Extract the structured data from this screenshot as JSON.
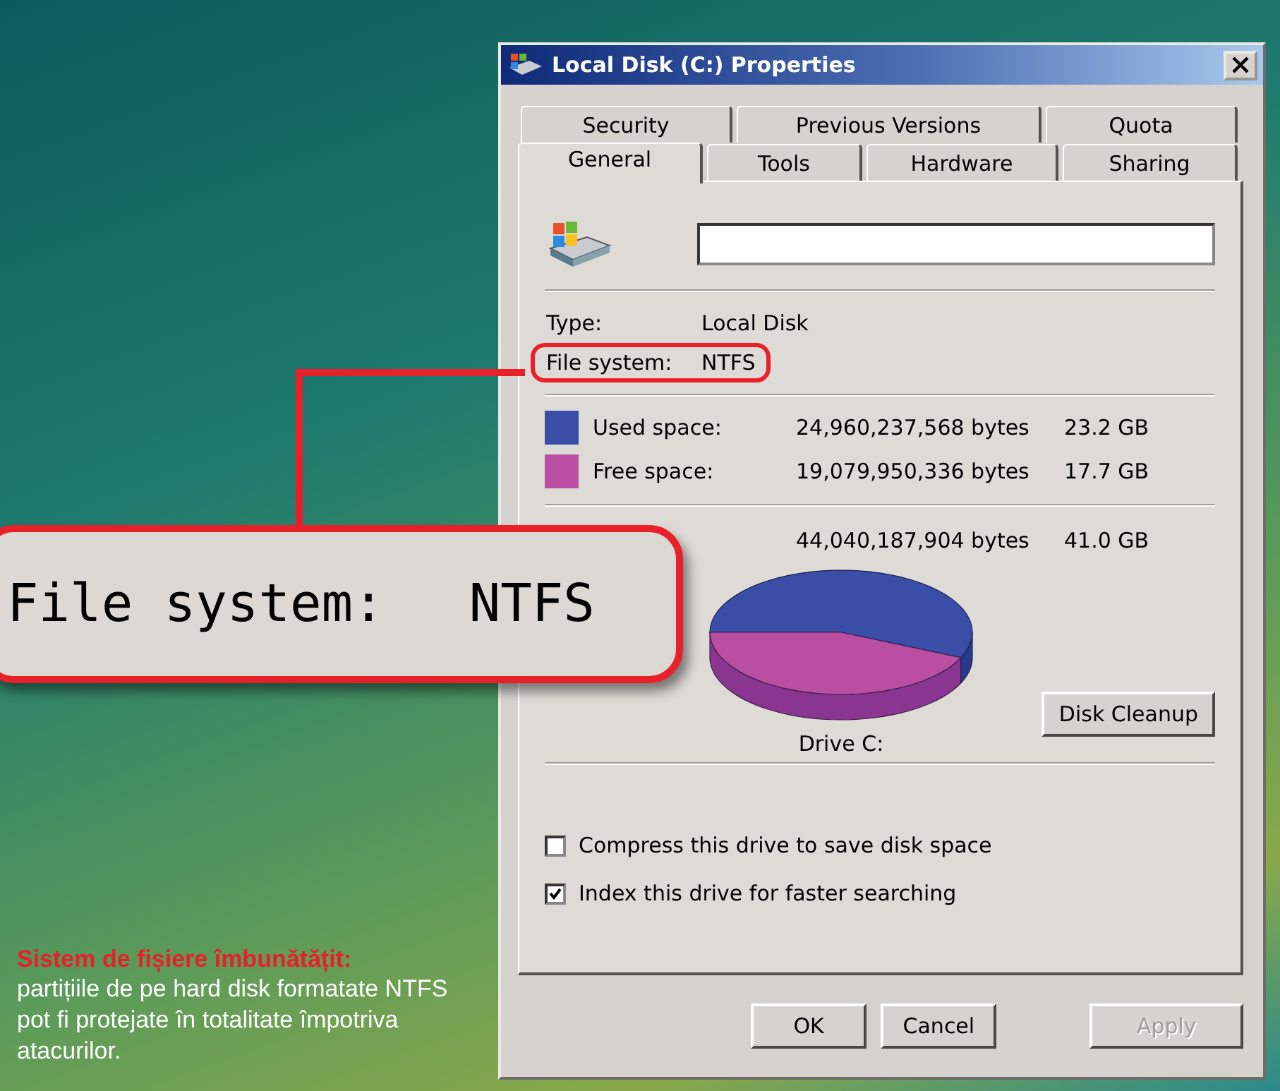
{
  "window": {
    "title": "Local Disk (C:) Properties"
  },
  "tab_rows": [
    [
      {
        "label": "Security",
        "selected": false
      },
      {
        "label": "Previous Versions",
        "selected": false
      },
      {
        "label": "Quota",
        "selected": false
      }
    ],
    [
      {
        "label": "General",
        "selected": true
      },
      {
        "label": "Tools",
        "selected": false
      },
      {
        "label": "Hardware",
        "selected": false
      },
      {
        "label": "Sharing",
        "selected": false
      }
    ]
  ],
  "info": [
    {
      "label": "Type:",
      "value": "Local Disk",
      "highlighted": false
    },
    {
      "label": "File system:",
      "value": "NTFS",
      "highlighted": true
    }
  ],
  "usage": [
    {
      "label": "Used space:",
      "bytes": "24,960,237,568 bytes",
      "size": "23.2 GB",
      "color": "#3a4ea8"
    },
    {
      "label": "Free space:",
      "bytes": "19,079,950,336 bytes",
      "size": "17.7 GB",
      "color": "#b94ea2"
    }
  ],
  "capacity": {
    "bytes": "44,040,187,904 bytes",
    "size": "41.0 GB"
  },
  "drive_label": "Drive C:",
  "disk_cleanup": "Disk Cleanup",
  "options": [
    {
      "label": "Compress this drive to save disk space",
      "checked": false
    },
    {
      "label": "Index this drive for faster searching",
      "checked": true
    }
  ],
  "buttons": [
    {
      "label": "OK",
      "disabled": false
    },
    {
      "label": "Cancel",
      "disabled": false
    },
    {
      "label": "Apply",
      "disabled": true
    }
  ],
  "callout": {
    "label": "File system:",
    "value": "NTFS"
  },
  "caption": {
    "heading": "Sistem de fișiere îmbunătățit:",
    "text": "partițiile de pe hard disk formatate NTFS pot fi protejate în totalitate împotriva atacurilor."
  }
}
